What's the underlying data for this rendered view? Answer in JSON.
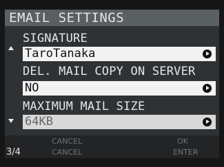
{
  "header": {
    "title": "EMAIL SETTINGS"
  },
  "settings": [
    {
      "label": "SIGNATURE",
      "value": "TaroTanaka"
    },
    {
      "label": "DEL. MAIL COPY ON SERVER",
      "value": "NO"
    },
    {
      "label": "MAXIMUM MAIL SIZE",
      "value": "64KB"
    }
  ],
  "footer": {
    "row1_left": "CANCEL",
    "row1_right": "OK",
    "page_indicator": "3/4",
    "row2_left": "CANCEL",
    "row2_right": "ENTER"
  },
  "icons": {
    "scroll_up": "up-triangle-icon",
    "scroll_down": "down-triangle-icon",
    "select_arrow": "circle-arrow-right-icon"
  },
  "colors": {
    "title_bar": "#5a5f62",
    "panel": "#2f3234",
    "field_bg": "#f2f2f2",
    "text_light": "#e6e6e6"
  }
}
